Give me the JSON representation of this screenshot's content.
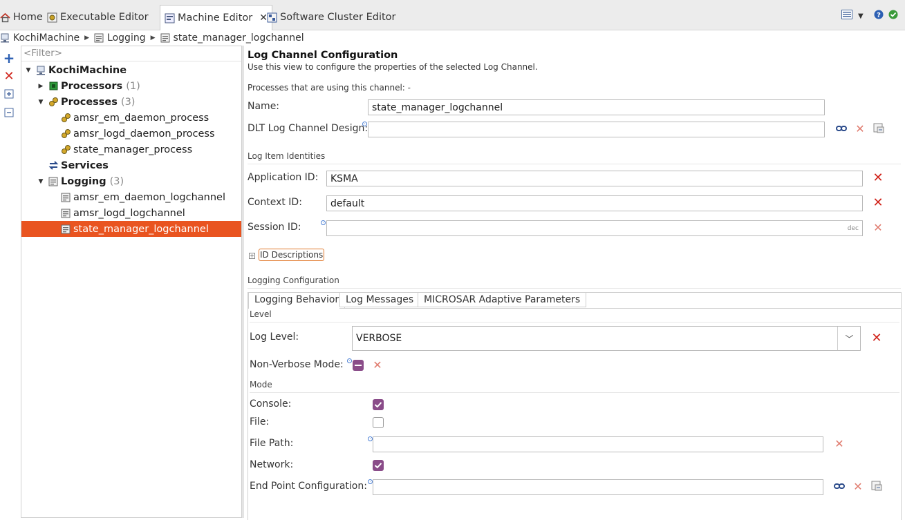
{
  "tabs": [
    {
      "label": "Home",
      "icon": "home-icon"
    },
    {
      "label": "Executable Editor",
      "icon": "executable-icon"
    },
    {
      "label": "Machine Editor",
      "icon": "machine-editor-icon",
      "active": true
    },
    {
      "label": "Software Cluster Editor",
      "icon": "cluster-icon"
    }
  ],
  "breadcrumb": [
    "KochiMachine",
    "Logging",
    "state_manager_logchannel"
  ],
  "tree": {
    "filter_placeholder": "<Filter>",
    "root": "KochiMachine",
    "processors": {
      "label": "Processors",
      "count": "(1)"
    },
    "processes": {
      "label": "Processes",
      "count": "(3)",
      "items": [
        "amsr_em_daemon_process",
        "amsr_logd_daemon_process",
        "state_manager_process"
      ]
    },
    "services": {
      "label": "Services"
    },
    "logging": {
      "label": "Logging",
      "count": "(3)",
      "items": [
        "amsr_em_daemon_logchannel",
        "amsr_logd_logchannel",
        "state_manager_logchannel"
      ]
    }
  },
  "form": {
    "title": "Log Channel Configuration",
    "description": "Use this view to configure the properties of the selected Log Channel.",
    "processes_using": "Processes that are using this channel: -",
    "name_label": "Name:",
    "name_value": "state_manager_logchannel",
    "dlt_label": "DLT Log Channel Design:",
    "dlt_value": "",
    "identities_section": "Log Item Identities",
    "app_id_label": "Application ID:",
    "app_id_value": "KSMA",
    "context_id_label": "Context ID:",
    "context_id_value": "default",
    "session_id_label": "Session ID:",
    "session_id_value": "",
    "session_id_hint": "dec",
    "id_descriptions": "ID Descriptions",
    "logging_section": "Logging Configuration",
    "subtabs": [
      "Logging Behavior",
      "Log Messages",
      "MICROSAR Adaptive Parameters"
    ],
    "level_section": "Level",
    "log_level_label": "Log Level:",
    "log_level_value": "VERBOSE",
    "non_verbose_label": "Non-Verbose Mode:",
    "mode_section": "Mode",
    "console_label": "Console:",
    "console_checked": true,
    "file_label": "File:",
    "file_checked": false,
    "file_path_label": "File Path:",
    "file_path_value": "",
    "network_label": "Network:",
    "network_checked": true,
    "endpoint_label": "End Point Configuration:",
    "endpoint_value": ""
  },
  "colors": {
    "selection": "#e95420",
    "accent_purple": "#8a4c89",
    "delete_red": "#d0231a"
  }
}
